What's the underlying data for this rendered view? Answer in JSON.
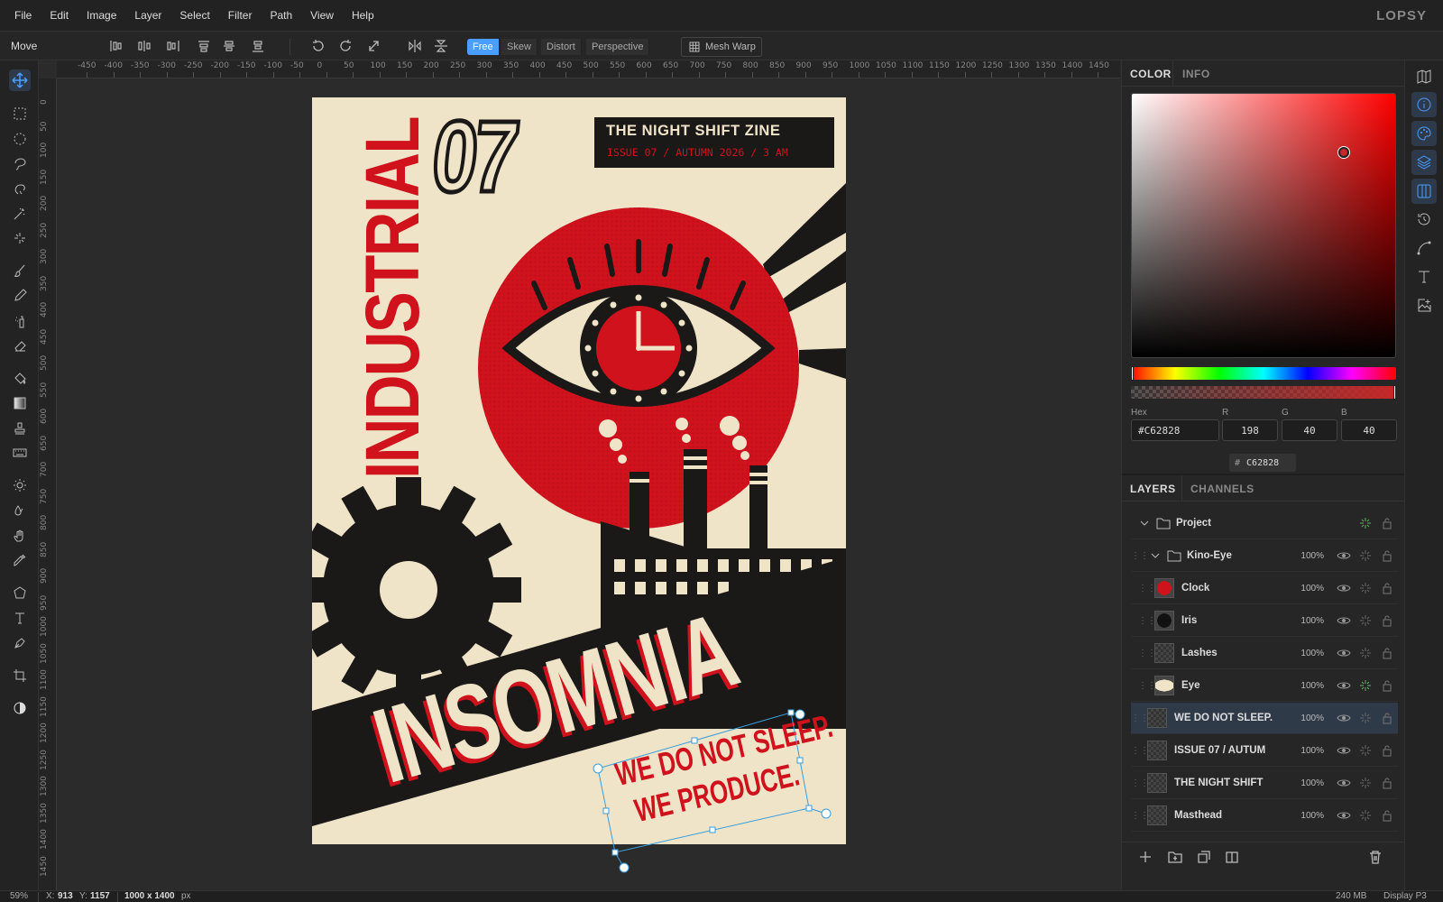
{
  "app": {
    "logo": "LOPSY"
  },
  "menu": [
    "File",
    "Edit",
    "Image",
    "Layer",
    "Select",
    "Filter",
    "Path",
    "View",
    "Help"
  ],
  "options": {
    "tool_name": "Move",
    "modes": [
      "Free",
      "Skew",
      "Distort",
      "Perspective"
    ],
    "active_mode": "Free",
    "mesh_warp": "Mesh Warp"
  },
  "ruler_h": [
    "-450",
    "-400",
    "-350",
    "-300",
    "-250",
    "-200",
    "-150",
    "-100",
    "-50",
    "0",
    "50",
    "100",
    "150",
    "200",
    "250",
    "300",
    "350",
    "400",
    "450",
    "500",
    "550",
    "600",
    "650",
    "700",
    "750",
    "800",
    "850",
    "900",
    "950",
    "1000",
    "1050",
    "1100",
    "1150",
    "1200",
    "1250",
    "1300",
    "1350",
    "1400",
    "1450"
  ],
  "ruler_v": [
    "0",
    "50",
    "100",
    "150",
    "200",
    "250",
    "300",
    "350",
    "400",
    "450",
    "500",
    "550",
    "600",
    "650",
    "700",
    "750",
    "800",
    "850",
    "900",
    "950",
    "1000",
    "1050",
    "1100",
    "1150",
    "1200",
    "1250",
    "1300",
    "1350",
    "1400",
    "1450"
  ],
  "poster": {
    "vertical_title": "INDUSTRIAL",
    "number": "07",
    "zine_title": "THE NIGHT SHIFT ZINE",
    "zine_issue": "ISSUE 07 / AUTUMN 2026 / 3 AM",
    "big_word": "INSOMNIA",
    "tagline_1": "WE DO NOT SLEEP.",
    "tagline_2": "WE PRODUCE."
  },
  "color_panel": {
    "tabs": [
      "COLOR",
      "INFO"
    ],
    "hex_label": "Hex",
    "hex": "#C62828",
    "r_label": "R",
    "r": "198",
    "g_label": "G",
    "g": "40",
    "b_label": "B",
    "b": "40",
    "hash_symbol": "#",
    "hex_short": "C62828"
  },
  "layers_panel": {
    "tabs": [
      "LAYERS",
      "CHANNELS"
    ],
    "layers": [
      {
        "name": "Project",
        "opacity": "",
        "indent": 0,
        "group": true
      },
      {
        "name": "Kino-Eye",
        "opacity": "100%",
        "indent": 1,
        "group": true
      },
      {
        "name": "Clock",
        "opacity": "100%",
        "indent": 2
      },
      {
        "name": "Iris",
        "opacity": "100%",
        "indent": 2
      },
      {
        "name": "Lashes",
        "opacity": "100%",
        "indent": 2
      },
      {
        "name": "Eye",
        "opacity": "100%",
        "indent": 2
      },
      {
        "name": "WE DO NOT SLEEP.",
        "opacity": "100%",
        "indent": 1,
        "selected": true
      },
      {
        "name": "ISSUE 07 / AUTUM",
        "opacity": "100%",
        "indent": 1
      },
      {
        "name": "THE NIGHT SHIFT",
        "opacity": "100%",
        "indent": 1
      },
      {
        "name": "Masthead",
        "opacity": "100%",
        "indent": 1
      }
    ]
  },
  "status": {
    "zoom": "59%",
    "x_label": "X:",
    "x": "913",
    "y_label": "Y:",
    "y": "1157",
    "doc_size": "1000 x 1400",
    "doc_unit": "px",
    "memory": "240 MB",
    "color_profile": "Display P3"
  },
  "colors": {
    "accent": "#4a9eff",
    "poster_red": "#d0121d",
    "poster_bg": "#efe3c8",
    "poster_black": "#1a1918"
  }
}
